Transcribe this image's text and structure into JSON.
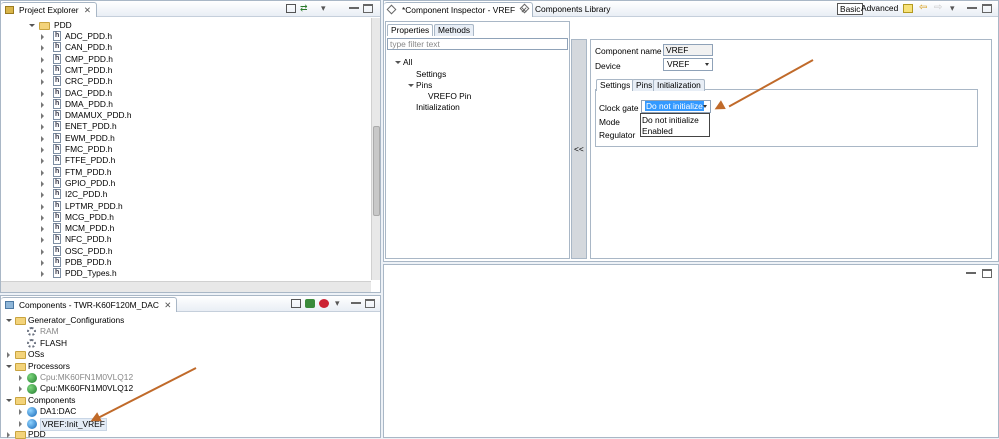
{
  "project_explorer": {
    "title": "Project Explorer",
    "root_folder": "PDD",
    "files": [
      "ADC_PDD.h",
      "CAN_PDD.h",
      "CMP_PDD.h",
      "CMT_PDD.h",
      "CRC_PDD.h",
      "DAC_PDD.h",
      "DMA_PDD.h",
      "DMAMUX_PDD.h",
      "ENET_PDD.h",
      "EWM_PDD.h",
      "FMC_PDD.h",
      "FTFE_PDD.h",
      "FTM_PDD.h",
      "GPIO_PDD.h",
      "I2C_PDD.h",
      "LPTMR_PDD.h",
      "MCG_PDD.h",
      "MCM_PDD.h",
      "NFC_PDD.h",
      "OSC_PDD.h",
      "PDB_PDD.h",
      "PDD_Types.h"
    ]
  },
  "components_view": {
    "title": "Components - TWR-K60F120M_DAC",
    "items": [
      {
        "label": "Generator_Configurations",
        "level": 0,
        "icon": "folder-icon",
        "state": "open"
      },
      {
        "label": "RAM",
        "level": 1,
        "icon": "gear-icon",
        "state": "none",
        "dim": true
      },
      {
        "label": "FLASH",
        "level": 1,
        "icon": "gear-icon",
        "state": "none",
        "dim": false
      },
      {
        "label": "OSs",
        "level": 0,
        "icon": "folder-icon",
        "state": "closed"
      },
      {
        "label": "Processors",
        "level": 0,
        "icon": "folder-icon",
        "state": "open"
      },
      {
        "label": "Cpu:MK60FN1M0VLQ12",
        "level": 1,
        "icon": "cpu-icon",
        "state": "closed",
        "dim": true
      },
      {
        "label": "Cpu:MK60FN1M0VLQ12",
        "level": 1,
        "icon": "cpu-icon",
        "state": "closed",
        "dim": false
      },
      {
        "label": "Components",
        "level": 0,
        "icon": "folder-icon",
        "state": "open"
      },
      {
        "label": "DA1:DAC",
        "level": 1,
        "icon": "component-icon",
        "state": "closed",
        "dim": false
      },
      {
        "label": "VREF:Init_VREF",
        "level": 1,
        "icon": "component-icon",
        "state": "closed",
        "dim": false,
        "selected": true
      },
      {
        "label": "PDD",
        "level": 0,
        "icon": "folder-icon",
        "state": "closed"
      }
    ]
  },
  "editor": {
    "tabs": [
      {
        "label": "*Component Inspector - VREF",
        "active": true
      },
      {
        "label": "Components Library",
        "active": false
      }
    ],
    "mode_basic": "Basic",
    "mode_advanced": "Advanced",
    "subtabs": [
      "Properties",
      "Methods"
    ],
    "filter_placeholder": "type filter text",
    "tree": [
      "All",
      "Settings",
      "Pins",
      "VREFO Pin",
      "Initialization"
    ],
    "collapse_button": "<<",
    "component_name_label": "Component name",
    "component_name_value": "VREF",
    "device_label": "Device",
    "device_value": "VREF",
    "inner_tabs": [
      "Settings",
      "Pins",
      "Initialization"
    ],
    "fields": [
      {
        "label": "Clock gate",
        "value": "Do not initialize"
      },
      {
        "label": "Mode",
        "value": ""
      },
      {
        "label": "Regulator",
        "value": ""
      }
    ],
    "dropdown_options": [
      "Do not initialize",
      "Enabled"
    ]
  },
  "colors": {
    "accent": "#c06a2a",
    "selection": "#3399ff"
  }
}
